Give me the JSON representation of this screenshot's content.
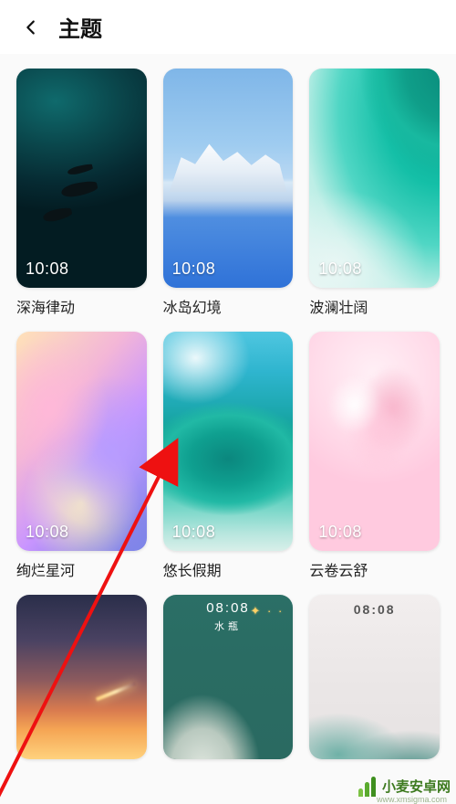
{
  "header": {
    "title": "主题"
  },
  "clock_time": "10:08",
  "alt_clock_time": "08:08",
  "themes": [
    {
      "id": "deep-sea",
      "name": "深海律动"
    },
    {
      "id": "iceland",
      "name": "冰岛幻境"
    },
    {
      "id": "waves",
      "name": "波澜壮阔"
    },
    {
      "id": "nebula",
      "name": "绚烂星河"
    },
    {
      "id": "holiday",
      "name": "悠长假期"
    },
    {
      "id": "clouds-pink",
      "name": "云卷云舒"
    }
  ],
  "aquarius_label": "水瓶",
  "watermark": {
    "brand": "小麦安卓网",
    "url": "www.xmsigma.com"
  }
}
